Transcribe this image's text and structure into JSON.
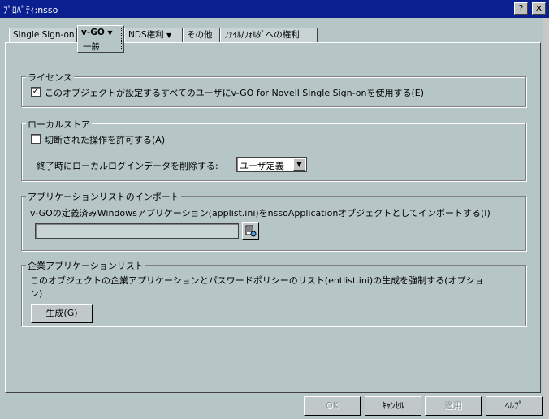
{
  "window": {
    "title": "ﾌﾟﾛﾊﾟﾃｨ:nsso",
    "help_glyph": "?",
    "close_glyph": "✕"
  },
  "tabs": [
    {
      "label": "Single Sign-on"
    },
    {
      "label": "v-GO",
      "arrow": "▼",
      "sub": "一般"
    },
    {
      "label": "NDS権利",
      "arrow": "▼"
    },
    {
      "label": "その他"
    },
    {
      "label": "ﾌｧｲﾙ/ﾌｫﾙﾀﾞへの権利"
    }
  ],
  "license": {
    "group_label": "ライセンス",
    "checkbox_label": "このオブジェクトが設定するすべてのユーザにv-GO for Novell Single Sign-onを使用する(E)",
    "checked": true
  },
  "local_store": {
    "group_label": "ローカルストア",
    "allow_offline_label": "切断された操作を許可する(A)",
    "allow_offline_checked": false,
    "delete_label": "終了時にローカルログインデータを削除する:",
    "delete_value": "ユーザ定義"
  },
  "app_import": {
    "group_label": "アプリケーションリストのインポート",
    "description": "v-GOの定義済みWindowsアプリケーション(applist.ini)をnssoApplicationオブジェクトとしてインポートする(I)",
    "path_value": ""
  },
  "enterprise": {
    "group_label": "企業アプリケーションリスト",
    "description_line1": "このオブジェクトの企業アプリケーションとパスワードポリシーのリスト(entlist.ini)の生成を強制する(オプショ",
    "description_line2": "ン)",
    "generate_label": "生成(G)"
  },
  "footer": {
    "ok_label": "OK",
    "cancel_label": "ｷｬﾝｾﾙ",
    "apply_label": "適用",
    "help_label": "ﾍﾙﾌﾟ"
  },
  "colors": {
    "titlebar": "#0a1f90",
    "face": "#b6c6c6"
  }
}
